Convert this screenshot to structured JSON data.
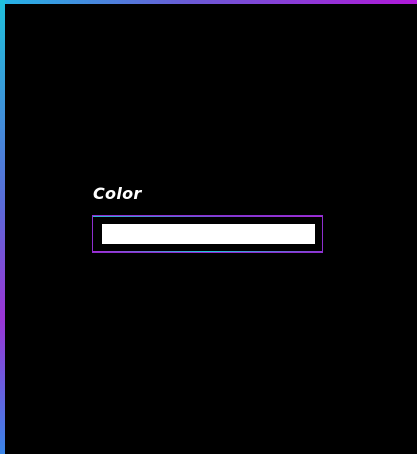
{
  "form": {
    "color_label": "Color",
    "color_value": "#ffffff"
  },
  "colors": {
    "background": "#000000",
    "accent_cyan": "#23b6e6",
    "accent_purple": "#b019d9"
  }
}
